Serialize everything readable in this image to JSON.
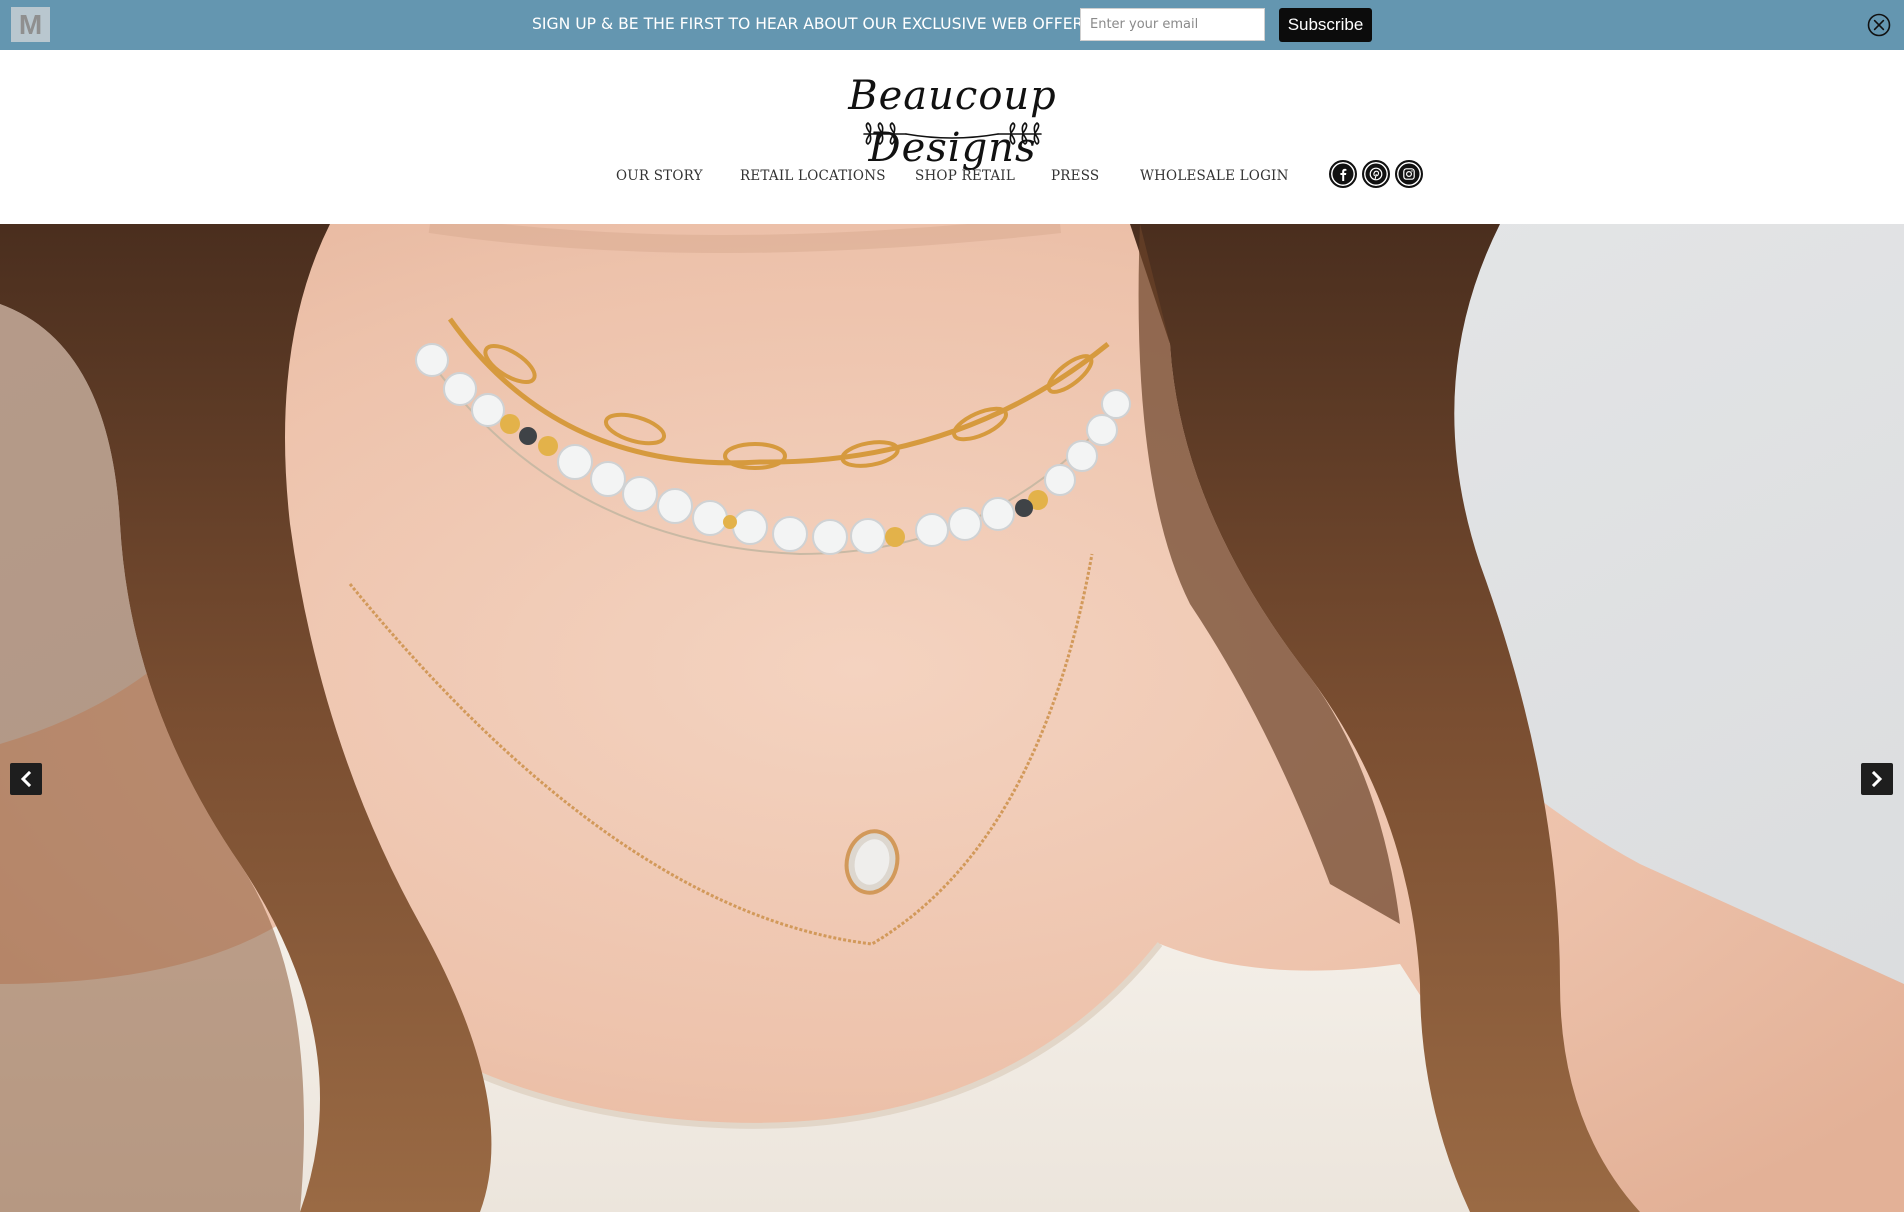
{
  "promo": {
    "logo_letter": "M",
    "message": "SIGN UP & BE THE FIRST TO HEAR ABOUT OUR EXCLUSIVE WEB OFFERS",
    "email_placeholder": "Enter your email",
    "email_value": "",
    "subscribe_label": "Subscribe",
    "close_icon": "close-circle-icon",
    "background_color": "#6496b0"
  },
  "header": {
    "brand_name": "Beaucoup Designs",
    "social": [
      {
        "name": "facebook",
        "icon": "facebook-icon"
      },
      {
        "name": "pinterest",
        "icon": "pinterest-icon"
      },
      {
        "name": "instagram",
        "icon": "instagram-icon"
      }
    ],
    "nav": [
      {
        "label": "OUR STORY"
      },
      {
        "label": "RETAIL LOCATIONS"
      },
      {
        "label": "SHOP RETAIL"
      },
      {
        "label": "PRESS"
      },
      {
        "label": "WHOLESALE LOGIN"
      }
    ]
  },
  "hero": {
    "prev_icon": "chevron-left-icon",
    "next_icon": "chevron-right-icon"
  }
}
